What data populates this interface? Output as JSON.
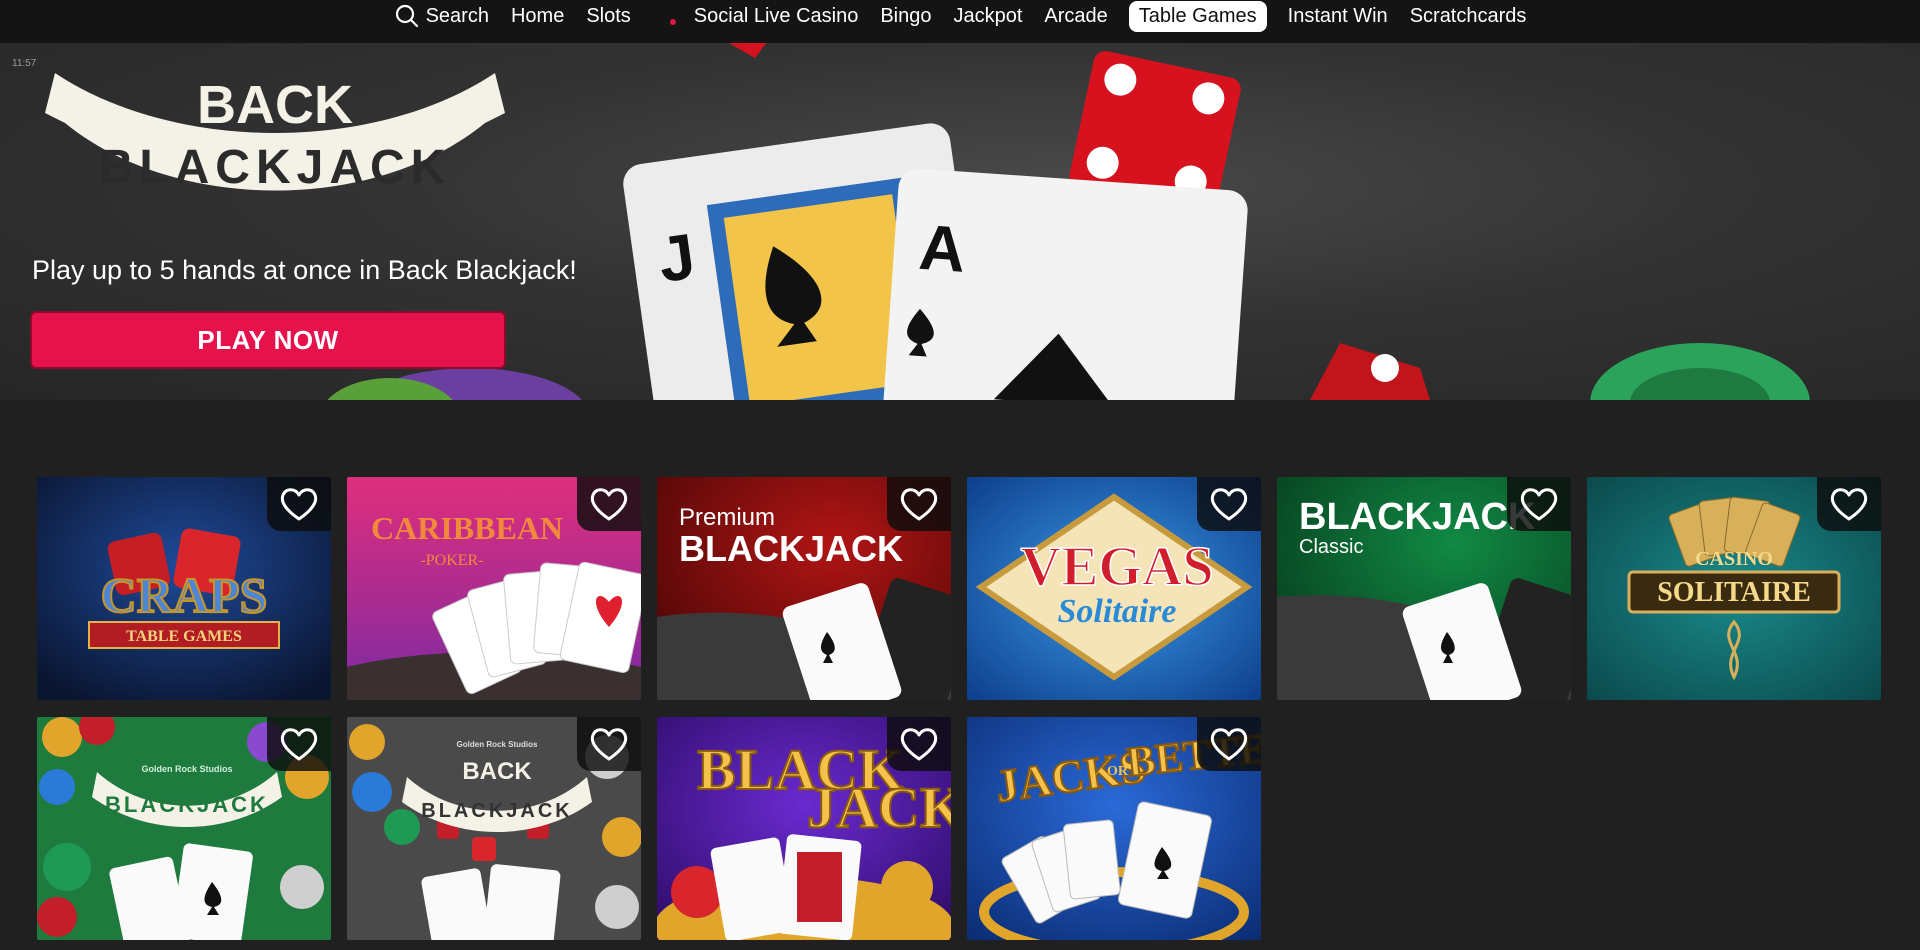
{
  "nav": {
    "search_label": "Search",
    "items": [
      "Home",
      "Slots",
      "Social Live Casino",
      "Bingo",
      "Jackpot",
      "Arcade",
      "Table Games",
      "Instant Win",
      "Scratchcards"
    ],
    "active": "Table Games",
    "live_dot_color": "#e0163d"
  },
  "hero": {
    "time": "11:57",
    "logo_top": "BACK",
    "logo_bottom": "BLACKJACK",
    "tagline": "Play up to 5 hands at once in Back Blackjack!",
    "cta": "PLAY NOW",
    "cta_color": "#e5124c",
    "card_left": "J",
    "card_right": "A"
  },
  "games": [
    {
      "title_line1": "CRAPS",
      "title_line2": "TABLE GAMES"
    },
    {
      "title_line1": "CARIBBEAN",
      "title_line2": "-POKER-"
    },
    {
      "title_line1": "Premium",
      "title_line2": "BLACKJACK"
    },
    {
      "title_line1": "VEGAS",
      "title_line2": "Solitaire"
    },
    {
      "title_line1": "BLACKJACK",
      "title_line2": "Classic"
    },
    {
      "title_line1": "CASINO",
      "title_line2": "SOLITAIRE"
    },
    {
      "title_line1": "BLACKJACK",
      "title_line2": "Golden Rock Studios"
    },
    {
      "title_line1": "BACK",
      "title_line2": "BLACKJACK",
      "title_line3": "Golden Rock Studios"
    },
    {
      "title_line1": "BLACK",
      "title_line2": "JACK"
    },
    {
      "title_line1": "JACKS",
      "title_line2": "OR",
      "title_line3": "BETTER"
    }
  ],
  "colors": {
    "page_bg": "#202020",
    "nav_bg": "#141414",
    "accent": "#e5124c"
  }
}
